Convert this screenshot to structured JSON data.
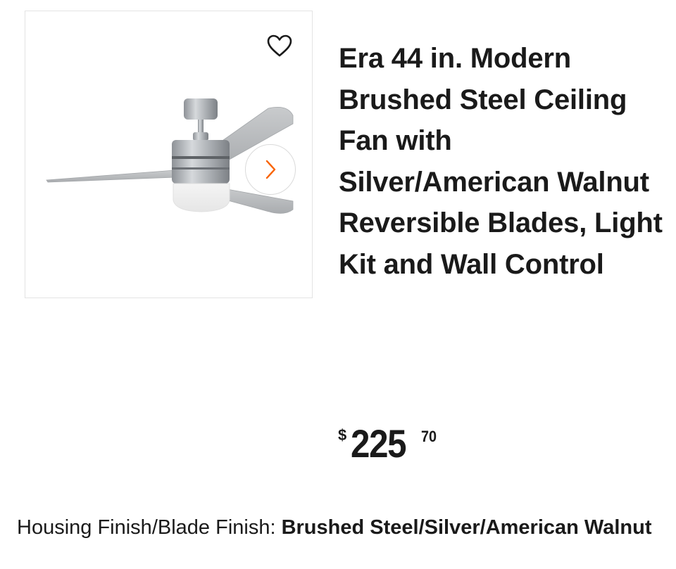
{
  "product": {
    "title": "Era 44 in. Modern Brushed Steel Ceiling Fan with Silver/American Walnut Reversible Blades, Light Kit and Wall Control",
    "price": {
      "currency": "$",
      "dollars": "225",
      "cents": "70"
    },
    "finish": {
      "label": "Housing Finish/Blade Finish: ",
      "value": "Brushed Steel/Silver/American Walnut"
    }
  },
  "icons": {
    "favorite": "heart-outline-icon",
    "next": "chevron-right-icon"
  },
  "colors": {
    "accent": "#f96302",
    "text": "#1a1a1a",
    "border": "#e3e3e3"
  }
}
